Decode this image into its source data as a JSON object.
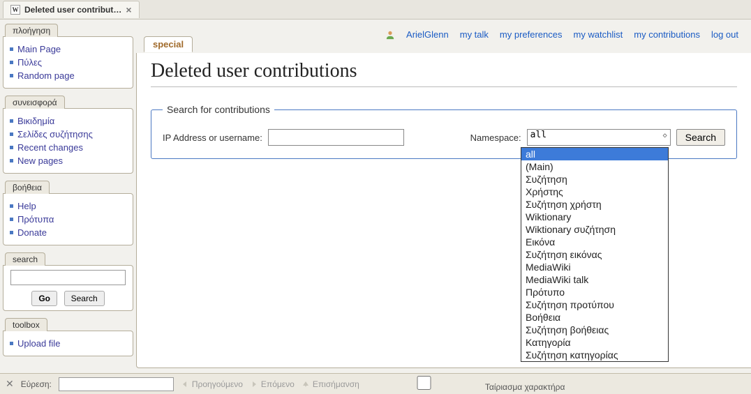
{
  "browser_tab": {
    "title": "Deleted user contribut…",
    "close": "×"
  },
  "sidebar": {
    "nav": {
      "title": "πλοήγηση",
      "items": [
        "Main Page",
        "Πύλες",
        "Random page"
      ]
    },
    "contrib": {
      "title": "συνεισφορά",
      "items": [
        "Βικιδημία",
        "Σελίδες συζήτησης",
        "Recent changes",
        "New pages"
      ]
    },
    "help": {
      "title": "βοήθεια",
      "items": [
        "Help",
        "Πρότυπα",
        "Donate"
      ]
    },
    "search": {
      "title": "search",
      "go": "Go",
      "search_btn": "Search"
    },
    "toolbox": {
      "title": "toolbox",
      "items": [
        "Upload file"
      ]
    }
  },
  "toplinks": {
    "user": "ArielGlenn",
    "talk": "my talk",
    "prefs": "my preferences",
    "watchlist": "my watchlist",
    "contribs": "my contributions",
    "logout": "log out"
  },
  "content_tab": "special",
  "page_title": "Deleted user contributions",
  "form": {
    "legend": "Search for contributions",
    "ip_label": "IP Address or username:",
    "ns_label": "Namespace:",
    "ns_selected": "all",
    "search_btn": "Search",
    "ns_options": [
      "all",
      "(Main)",
      "Συζήτηση",
      "Χρήστης",
      "Συζήτηση χρήστη",
      "Wiktionary",
      "Wiktionary συζήτηση",
      "Εικόνα",
      "Συζήτηση εικόνας",
      "MediaWiki",
      "MediaWiki talk",
      "Πρότυπο",
      "Συζήτηση προτύπου",
      "Βοήθεια",
      "Συζήτηση βοήθειας",
      "Κατηγορία",
      "Συζήτηση κατηγορίας"
    ]
  },
  "findbar": {
    "label": "Εύρεση:",
    "prev": "Προηγούμενο",
    "next": "Επόμενο",
    "highlight": "Επισήμανση",
    "case": "Ταίριασμα χαρακτήρα"
  }
}
